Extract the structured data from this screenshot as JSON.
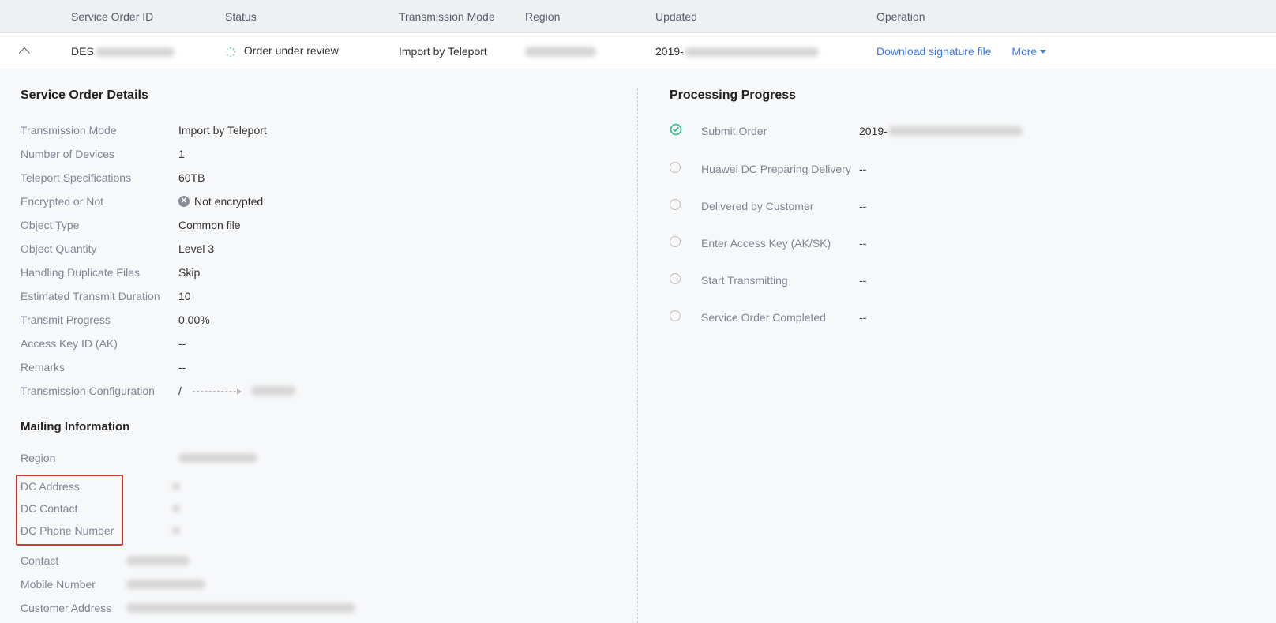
{
  "headers": {
    "id": "Service Order ID",
    "status": "Status",
    "mode": "Transmission Mode",
    "region": "Region",
    "updated": "Updated",
    "operation": "Operation"
  },
  "row": {
    "id_prefix": "DES",
    "status_text": "Order under review",
    "mode": "Import by Teleport",
    "updated_prefix": "2019-",
    "download": "Download signature file",
    "more": "More"
  },
  "details": {
    "title": "Service Order Details",
    "items": {
      "transmission_mode": {
        "label": "Transmission Mode",
        "value": "Import by Teleport"
      },
      "num_devices": {
        "label": "Number of Devices",
        "value": "1"
      },
      "teleport_spec": {
        "label": "Teleport Specifications",
        "value": "60TB"
      },
      "encrypted": {
        "label": "Encrypted or Not",
        "value": "Not encrypted"
      },
      "object_type": {
        "label": "Object Type",
        "value": "Common file"
      },
      "object_qty": {
        "label": "Object Quantity",
        "value": "Level 3"
      },
      "dup_files": {
        "label": "Handling Duplicate Files",
        "value": "Skip"
      },
      "est_duration": {
        "label": "Estimated Transmit Duration",
        "value": "10"
      },
      "transmit_prog": {
        "label": "Transmit Progress",
        "value": "0.00%"
      },
      "ak": {
        "label": "Access Key ID (AK)",
        "value": "--"
      },
      "remarks": {
        "label": "Remarks",
        "value": "--"
      },
      "trans_config": {
        "label": "Transmission Configuration",
        "value": "/"
      }
    }
  },
  "mailing": {
    "title": "Mailing Information",
    "region": {
      "label": "Region"
    },
    "dc_address": {
      "label": "DC Address"
    },
    "dc_contact": {
      "label": "DC Contact"
    },
    "dc_phone": {
      "label": "DC Phone Number"
    },
    "contact": {
      "label": "Contact"
    },
    "mobile": {
      "label": "Mobile Number"
    },
    "cust_addr": {
      "label": "Customer Address"
    }
  },
  "progress": {
    "title": "Processing Progress",
    "steps": {
      "submit": {
        "label": "Submit Order",
        "value_prefix": "2019-"
      },
      "dc_prep": {
        "label": "Huawei DC Preparing Delivery",
        "value": "--"
      },
      "delivered": {
        "label": "Delivered by Customer",
        "value": "--"
      },
      "ak_sk": {
        "label": "Enter Access Key (AK/SK)",
        "value": "--"
      },
      "start": {
        "label": "Start Transmitting",
        "value": "--"
      },
      "complete": {
        "label": "Service Order Completed",
        "value": "--"
      }
    }
  }
}
